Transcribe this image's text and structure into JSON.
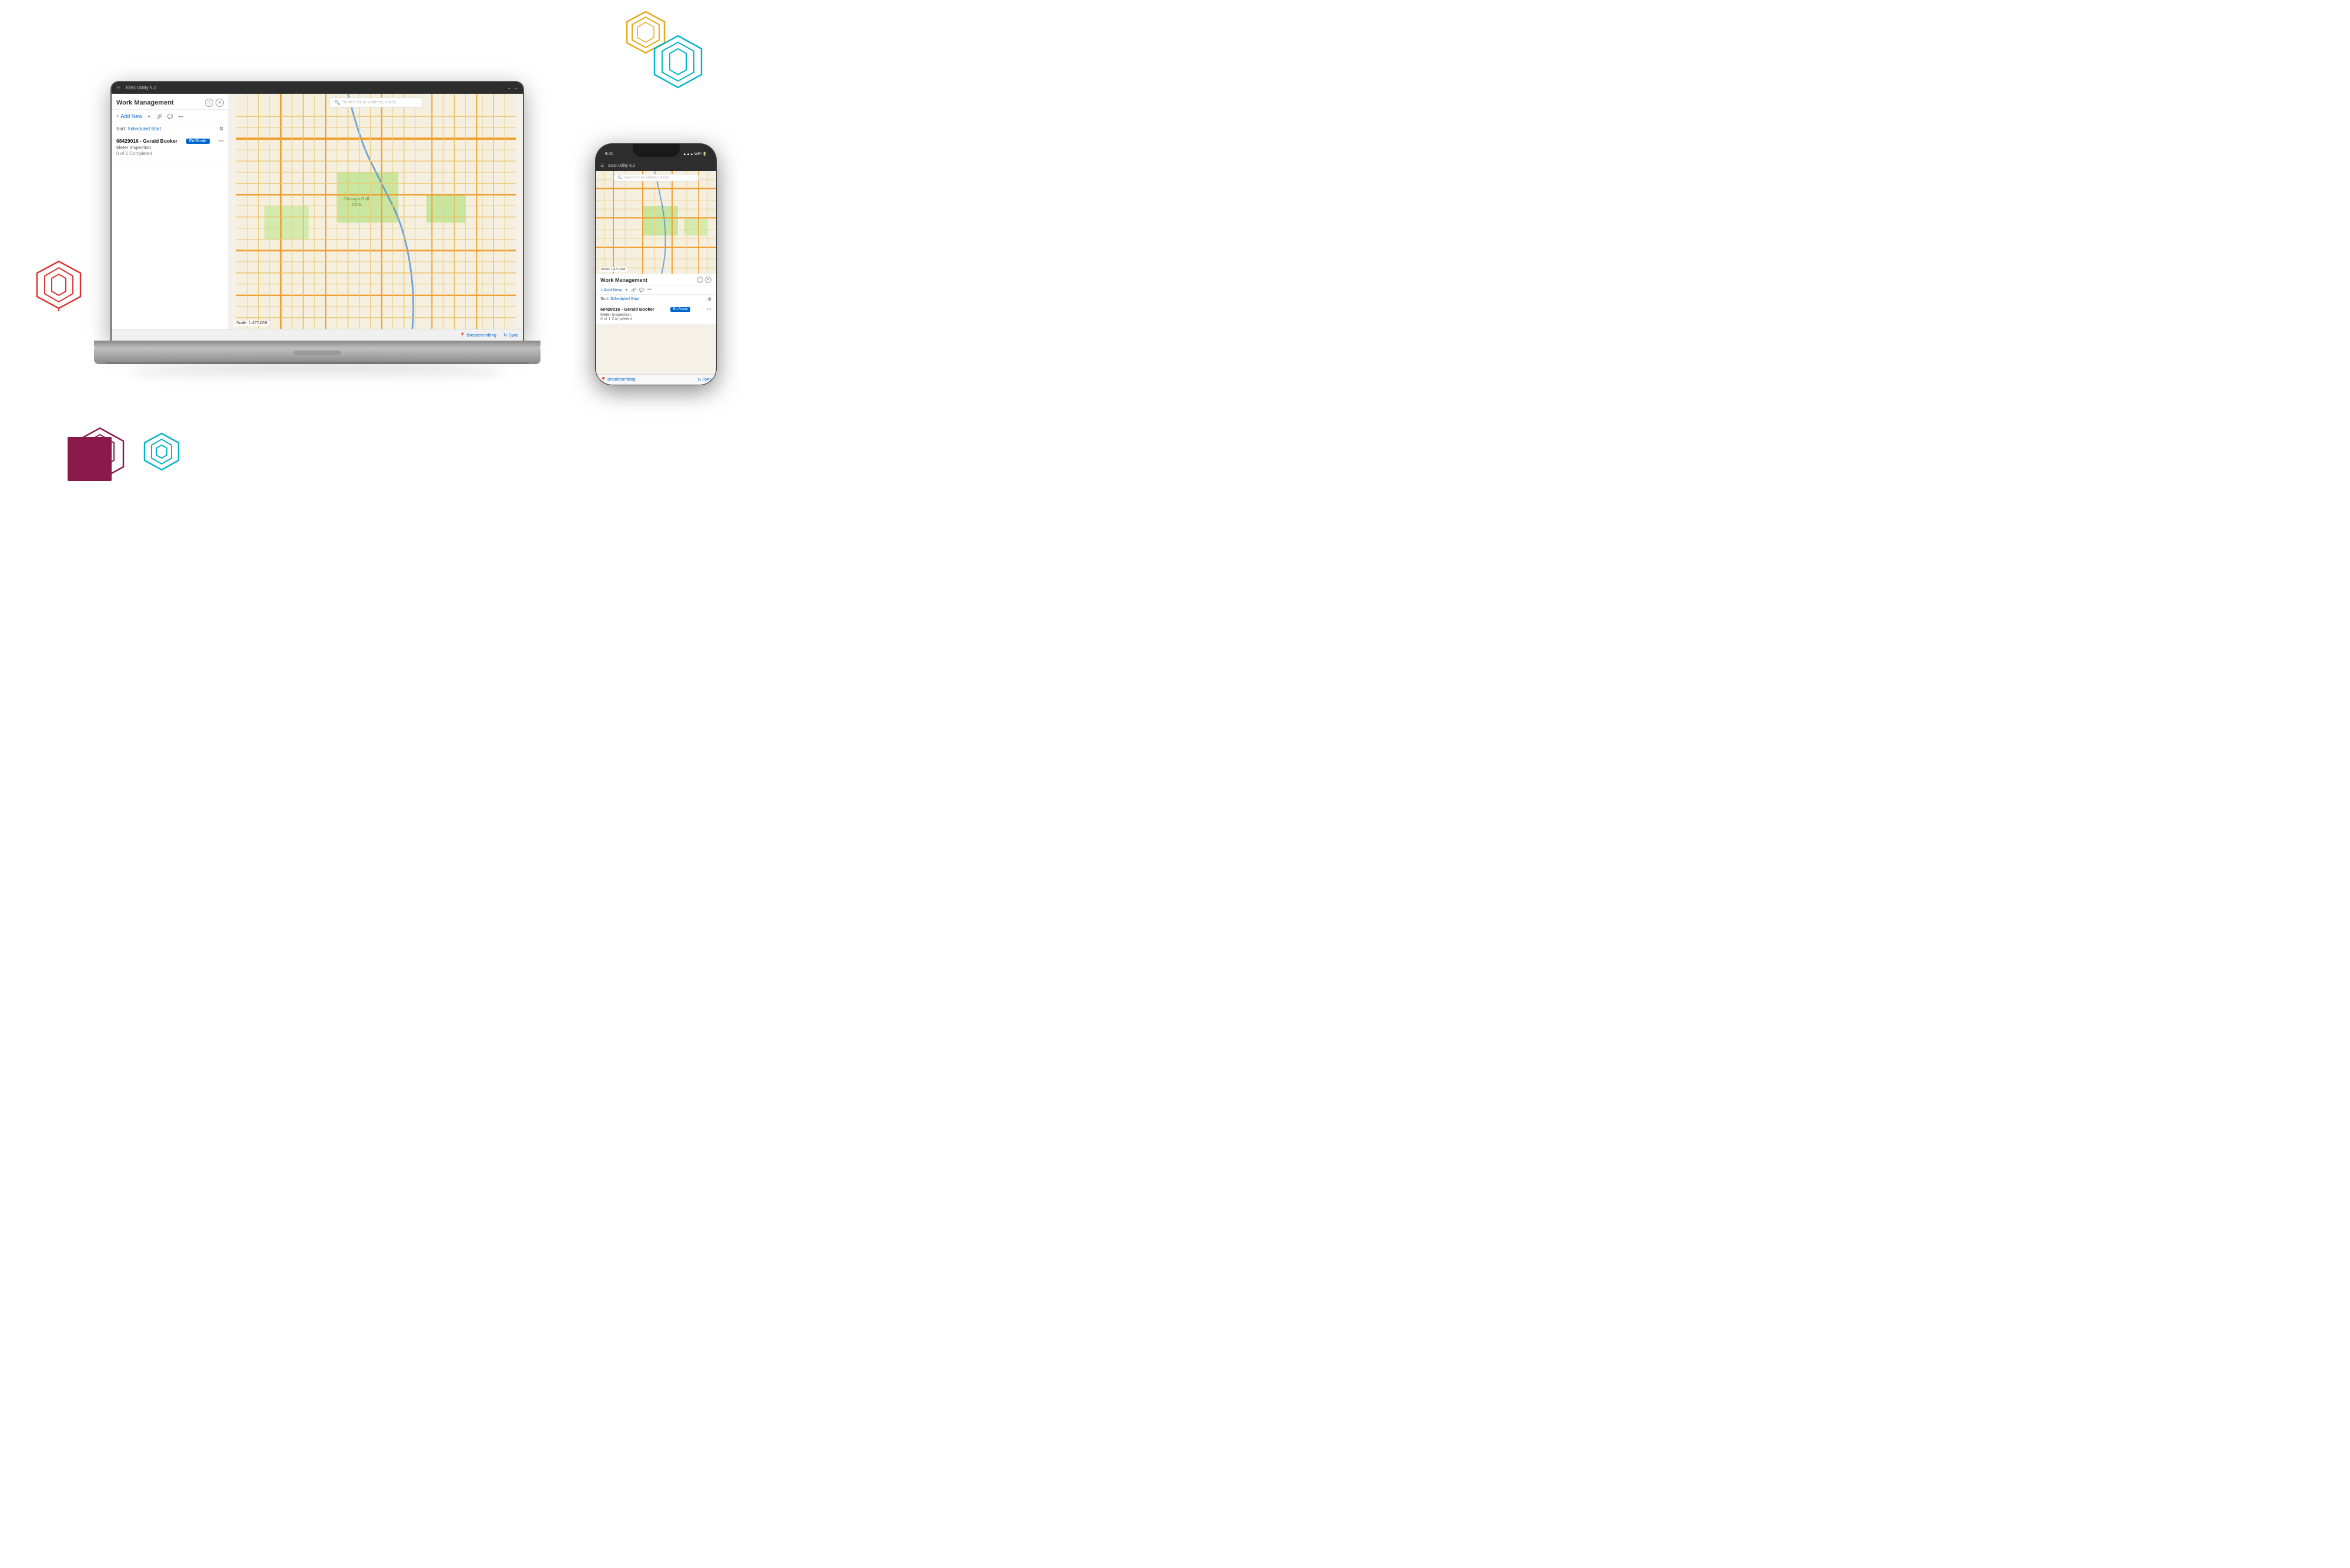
{
  "app": {
    "title": "ESG Utility 5.2",
    "search_placeholder": "Search for an address, asset...",
    "scale": "Scale: 1:477,038"
  },
  "work_management": {
    "title": "Work Management",
    "add_new_label": "+ Add New",
    "sort_prefix": "Sort:",
    "sort_value": "Scheduled Start",
    "sort_arrow": "↓",
    "item": {
      "id": "68429016 - Gerald Booker",
      "badge": "En-Route",
      "type": "Meter Inspection",
      "progress": "0 of 1 Completed"
    },
    "bottom_breadcrumb": "Breadcrumbing",
    "bottom_sync": "Sync"
  },
  "phone": {
    "status": {
      "time": "9:41",
      "signal": "●●●",
      "wifi": "WiFi",
      "battery": "100%"
    },
    "app_title": "ESG Utility 5.2",
    "search_placeholder": "Search for an address, asset...",
    "scale": "Scale: 1:477,038",
    "work_management": {
      "title": "Work Management",
      "add_new_label": "+ Add New",
      "sort_prefix": "Sort:",
      "sort_value": "Scheduled Start",
      "item": {
        "id": "68429016 - Gerald Booker",
        "badge": "En-Route",
        "type": "Meter Inspection",
        "progress": "0 of 1 Completed"
      },
      "bottom_breadcrumb": "Breadcrumbing",
      "bottom_sync": "Sync"
    }
  },
  "decorations": {
    "hex_gold_color": "#e6a817",
    "hex_teal_color": "#00b5c8",
    "hex_red_color": "#e03030",
    "hex_maroon_color": "#8b1a4a",
    "hex_teal2_color": "#00b5c8"
  }
}
